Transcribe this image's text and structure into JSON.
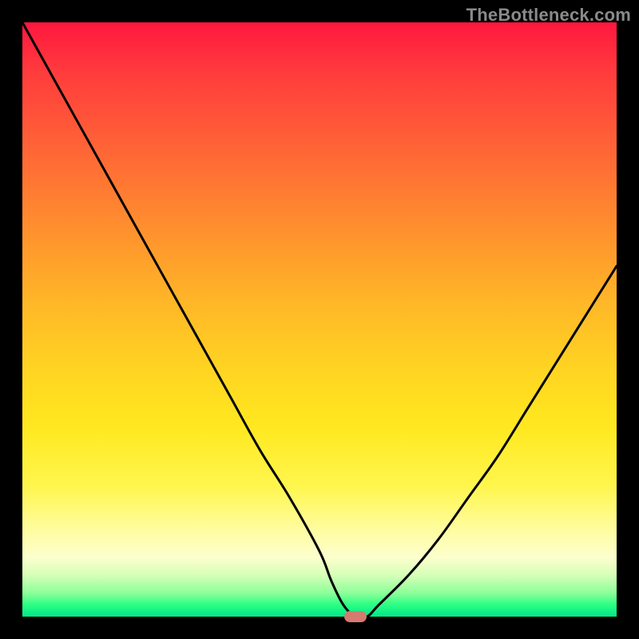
{
  "watermark": "TheBottleneck.com",
  "colors": {
    "curve": "#000000",
    "marker": "#d57a6f",
    "frame": "#000000"
  },
  "chart_data": {
    "type": "line",
    "title": "",
    "xlabel": "",
    "ylabel": "",
    "xlim": [
      0,
      100
    ],
    "ylim": [
      0,
      100
    ],
    "grid": false,
    "series": [
      {
        "name": "bottleneck-curve",
        "x": [
          0,
          5,
          10,
          15,
          20,
          25,
          30,
          35,
          40,
          45,
          50,
          52,
          54,
          56,
          58,
          60,
          65,
          70,
          75,
          80,
          85,
          90,
          95,
          100
        ],
        "values": [
          100,
          91,
          82,
          73,
          64,
          55,
          46,
          37,
          28,
          20,
          11,
          6,
          2,
          0,
          0,
          2,
          7,
          13,
          20,
          27,
          35,
          43,
          51,
          59
        ]
      }
    ],
    "marker": {
      "x": 56,
      "y": 0
    },
    "annotations": []
  }
}
